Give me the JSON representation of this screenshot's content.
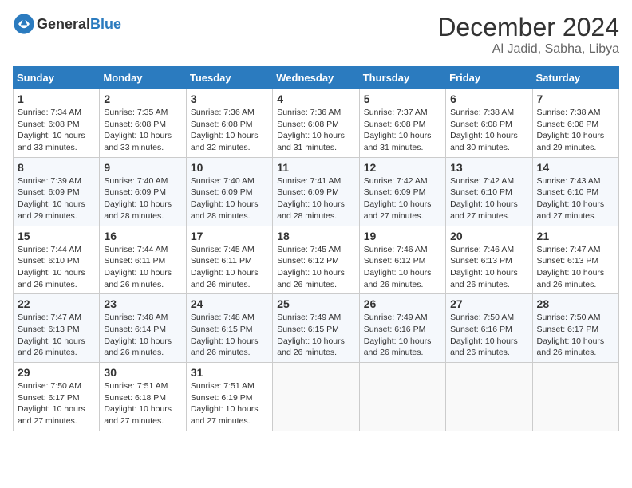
{
  "header": {
    "logo_general": "General",
    "logo_blue": "Blue",
    "month_title": "December 2024",
    "location": "Al Jadid, Sabha, Libya"
  },
  "calendar": {
    "days_of_week": [
      "Sunday",
      "Monday",
      "Tuesday",
      "Wednesday",
      "Thursday",
      "Friday",
      "Saturday"
    ],
    "weeks": [
      [
        null,
        null,
        null,
        null,
        null,
        null,
        null
      ]
    ],
    "cells": [
      {
        "day": 1,
        "col": 0,
        "sunrise": "7:34 AM",
        "sunset": "6:08 PM",
        "daylight": "10 hours and 33 minutes."
      },
      {
        "day": 2,
        "col": 1,
        "sunrise": "7:35 AM",
        "sunset": "6:08 PM",
        "daylight": "10 hours and 33 minutes."
      },
      {
        "day": 3,
        "col": 2,
        "sunrise": "7:36 AM",
        "sunset": "6:08 PM",
        "daylight": "10 hours and 32 minutes."
      },
      {
        "day": 4,
        "col": 3,
        "sunrise": "7:36 AM",
        "sunset": "6:08 PM",
        "daylight": "10 hours and 31 minutes."
      },
      {
        "day": 5,
        "col": 4,
        "sunrise": "7:37 AM",
        "sunset": "6:08 PM",
        "daylight": "10 hours and 31 minutes."
      },
      {
        "day": 6,
        "col": 5,
        "sunrise": "7:38 AM",
        "sunset": "6:08 PM",
        "daylight": "10 hours and 30 minutes."
      },
      {
        "day": 7,
        "col": 6,
        "sunrise": "7:38 AM",
        "sunset": "6:08 PM",
        "daylight": "10 hours and 29 minutes."
      },
      {
        "day": 8,
        "col": 0,
        "sunrise": "7:39 AM",
        "sunset": "6:09 PM",
        "daylight": "10 hours and 29 minutes."
      },
      {
        "day": 9,
        "col": 1,
        "sunrise": "7:40 AM",
        "sunset": "6:09 PM",
        "daylight": "10 hours and 28 minutes."
      },
      {
        "day": 10,
        "col": 2,
        "sunrise": "7:40 AM",
        "sunset": "6:09 PM",
        "daylight": "10 hours and 28 minutes."
      },
      {
        "day": 11,
        "col": 3,
        "sunrise": "7:41 AM",
        "sunset": "6:09 PM",
        "daylight": "10 hours and 28 minutes."
      },
      {
        "day": 12,
        "col": 4,
        "sunrise": "7:42 AM",
        "sunset": "6:09 PM",
        "daylight": "10 hours and 27 minutes."
      },
      {
        "day": 13,
        "col": 5,
        "sunrise": "7:42 AM",
        "sunset": "6:10 PM",
        "daylight": "10 hours and 27 minutes."
      },
      {
        "day": 14,
        "col": 6,
        "sunrise": "7:43 AM",
        "sunset": "6:10 PM",
        "daylight": "10 hours and 27 minutes."
      },
      {
        "day": 15,
        "col": 0,
        "sunrise": "7:44 AM",
        "sunset": "6:10 PM",
        "daylight": "10 hours and 26 minutes."
      },
      {
        "day": 16,
        "col": 1,
        "sunrise": "7:44 AM",
        "sunset": "6:11 PM",
        "daylight": "10 hours and 26 minutes."
      },
      {
        "day": 17,
        "col": 2,
        "sunrise": "7:45 AM",
        "sunset": "6:11 PM",
        "daylight": "10 hours and 26 minutes."
      },
      {
        "day": 18,
        "col": 3,
        "sunrise": "7:45 AM",
        "sunset": "6:12 PM",
        "daylight": "10 hours and 26 minutes."
      },
      {
        "day": 19,
        "col": 4,
        "sunrise": "7:46 AM",
        "sunset": "6:12 PM",
        "daylight": "10 hours and 26 minutes."
      },
      {
        "day": 20,
        "col": 5,
        "sunrise": "7:46 AM",
        "sunset": "6:13 PM",
        "daylight": "10 hours and 26 minutes."
      },
      {
        "day": 21,
        "col": 6,
        "sunrise": "7:47 AM",
        "sunset": "6:13 PM",
        "daylight": "10 hours and 26 minutes."
      },
      {
        "day": 22,
        "col": 0,
        "sunrise": "7:47 AM",
        "sunset": "6:13 PM",
        "daylight": "10 hours and 26 minutes."
      },
      {
        "day": 23,
        "col": 1,
        "sunrise": "7:48 AM",
        "sunset": "6:14 PM",
        "daylight": "10 hours and 26 minutes."
      },
      {
        "day": 24,
        "col": 2,
        "sunrise": "7:48 AM",
        "sunset": "6:15 PM",
        "daylight": "10 hours and 26 minutes."
      },
      {
        "day": 25,
        "col": 3,
        "sunrise": "7:49 AM",
        "sunset": "6:15 PM",
        "daylight": "10 hours and 26 minutes."
      },
      {
        "day": 26,
        "col": 4,
        "sunrise": "7:49 AM",
        "sunset": "6:16 PM",
        "daylight": "10 hours and 26 minutes."
      },
      {
        "day": 27,
        "col": 5,
        "sunrise": "7:50 AM",
        "sunset": "6:16 PM",
        "daylight": "10 hours and 26 minutes."
      },
      {
        "day": 28,
        "col": 6,
        "sunrise": "7:50 AM",
        "sunset": "6:17 PM",
        "daylight": "10 hours and 26 minutes."
      },
      {
        "day": 29,
        "col": 0,
        "sunrise": "7:50 AM",
        "sunset": "6:17 PM",
        "daylight": "10 hours and 27 minutes."
      },
      {
        "day": 30,
        "col": 1,
        "sunrise": "7:51 AM",
        "sunset": "6:18 PM",
        "daylight": "10 hours and 27 minutes."
      },
      {
        "day": 31,
        "col": 2,
        "sunrise": "7:51 AM",
        "sunset": "6:19 PM",
        "daylight": "10 hours and 27 minutes."
      }
    ]
  }
}
